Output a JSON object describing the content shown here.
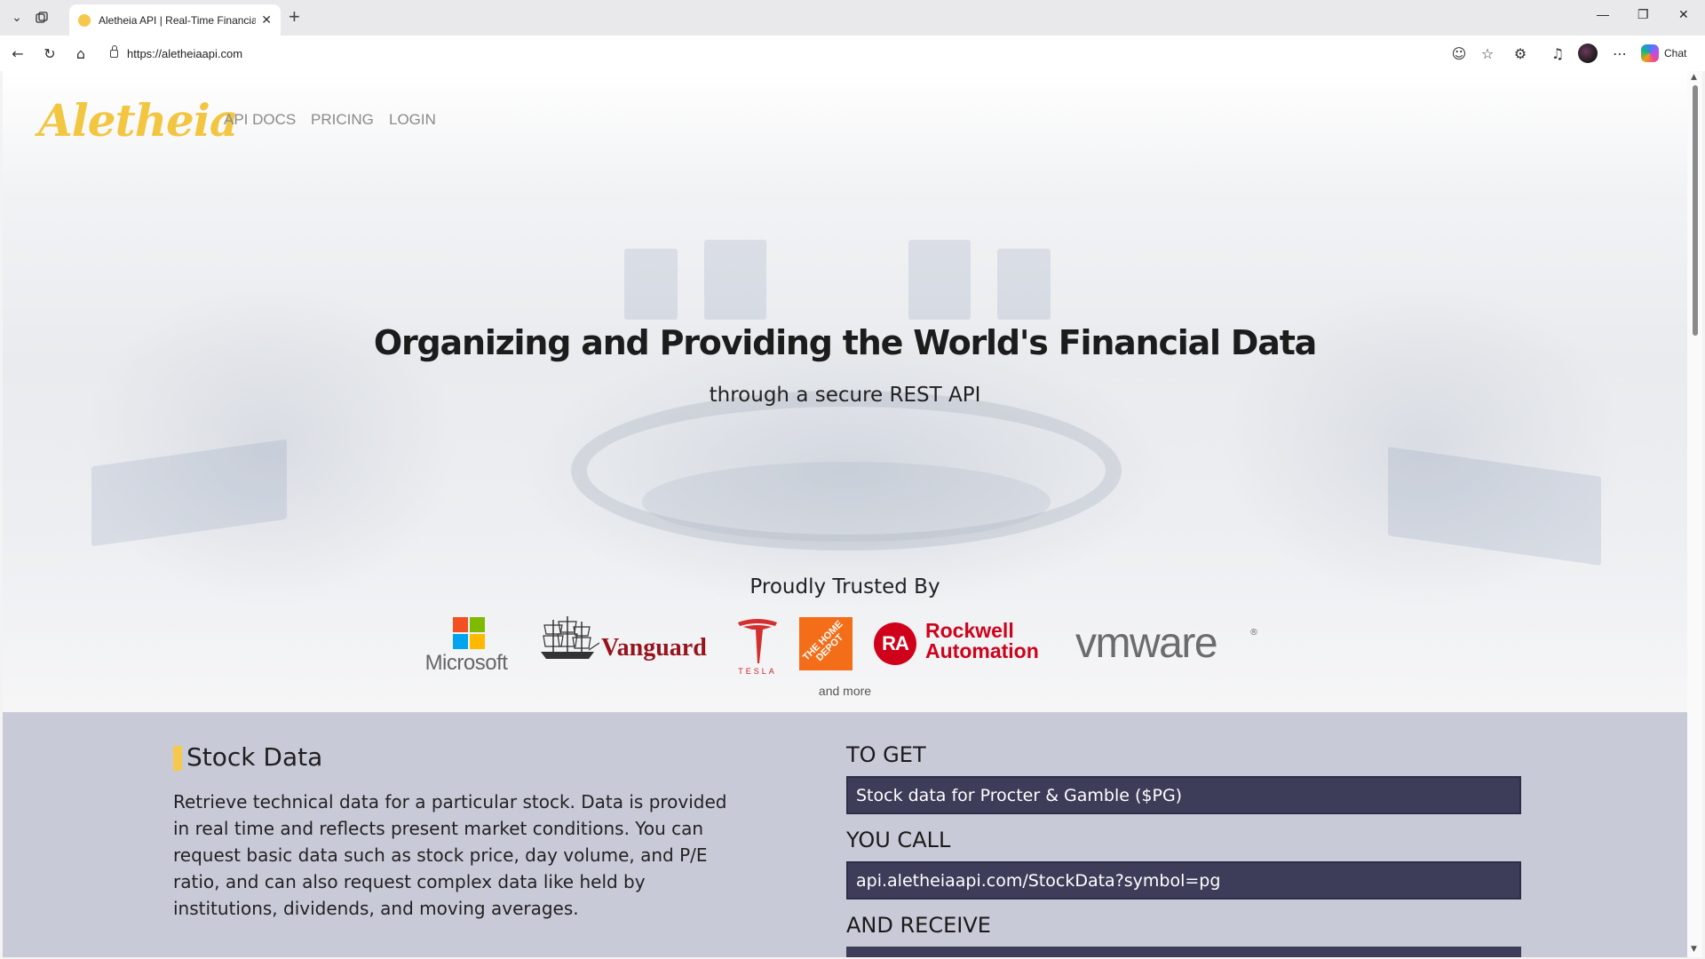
{
  "browser": {
    "tab_title": "Aletheia API | Real-Time Financial",
    "url": "https://aletheiaapi.com",
    "chat_label": "Chat"
  },
  "site": {
    "brand": "Aletheia",
    "nav": [
      "API DOCS",
      "PRICING",
      "LOGIN"
    ],
    "hero": {
      "title": "Organizing and Providing the World's Financial Data",
      "subtitle": "through a secure REST API"
    },
    "trusted": {
      "heading": "Proudly Trusted By",
      "logos": {
        "microsoft": "Microsoft",
        "vanguard": "Vanguard",
        "tesla": "TESLA",
        "home_depot": "THE HOME DEPOT",
        "rockwell_badge": "RA",
        "rockwell_line1": "Rockwell",
        "rockwell_line2": "Automation",
        "vmware": "vmware"
      },
      "more": "and more"
    },
    "feature": {
      "title": "Stock Data",
      "description": "Retrieve technical data for a particular stock. Data is provided in real time and reflects present market conditions. You can request basic data such as stock price, day volume, and P/E ratio, and can also request complex data like held by institutions, dividends, and moving averages.",
      "to_get_label": "TO GET",
      "to_get_value": "Stock data for Procter & Gamble ($PG)",
      "you_call_label": "YOU CALL",
      "you_call_value": "api.aletheiaapi.com/StockData?symbol=pg",
      "and_receive_label": "AND RECEIVE"
    }
  },
  "colors": {
    "brand_yellow": "#f2c640",
    "feature_bg": "#c9cad8",
    "code_box": "#3d3d5a"
  }
}
